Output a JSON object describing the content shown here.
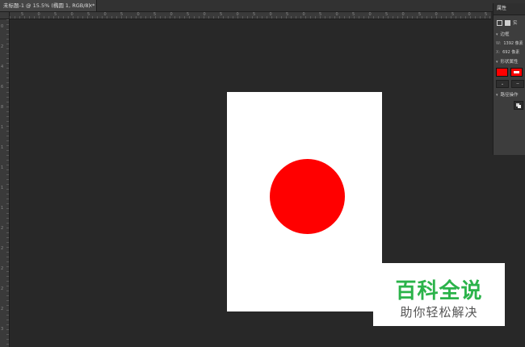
{
  "document_tab": {
    "title": "未标题-1 @ 15.5% (椭圆 1, RGB/8) *",
    "close_glyph": "×"
  },
  "ruler": {
    "top_labels": [
      "5",
      "0",
      "5",
      "0",
      "5",
      "0",
      "5",
      "0",
      "5",
      "0",
      "5",
      "0",
      "5",
      "0",
      "5",
      "0",
      "5",
      "0",
      "5",
      "0",
      "5",
      "0",
      "5",
      "0",
      "5",
      "0",
      "5",
      "0",
      "5"
    ],
    "left_labels": [
      "0",
      "2",
      "4",
      "6",
      "8",
      "1",
      "1",
      "1",
      "1",
      "1",
      "2",
      "2",
      "2",
      "2",
      "2",
      "3"
    ]
  },
  "canvas": {
    "artboard_color": "#ffffff",
    "circle_color": "#ff0000"
  },
  "properties_panel": {
    "title": "属性",
    "icon_label": "实",
    "section_border": "边框",
    "width_key": "W:",
    "width_value": "1392 像素",
    "x_key": "X:",
    "x_value": "692 像素",
    "section_shape": "形状属性",
    "fill_color": "#ff0000",
    "stroke_color": "#ff0000",
    "stroke_option": "∽",
    "section_path_ops": "路径操作"
  },
  "watermark": {
    "title": "百科全说",
    "subtitle": "助你轻松解决"
  }
}
